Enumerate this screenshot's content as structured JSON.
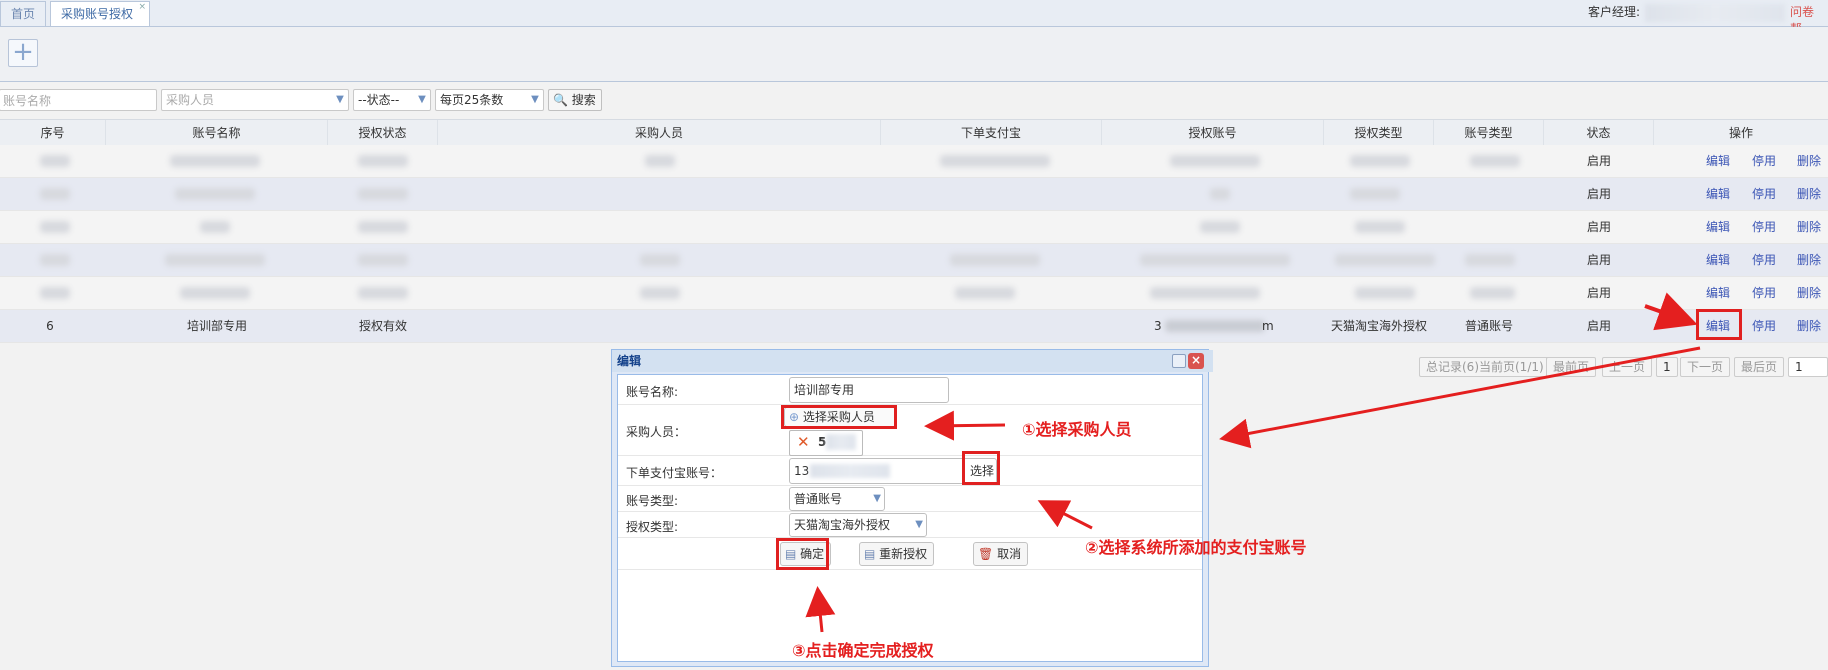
{
  "tabs": [
    {
      "label": "首页"
    },
    {
      "label": "采购账号授权",
      "close": "×"
    }
  ],
  "header": {
    "manager_label": "客户经理:",
    "help_text": "问卷 帮"
  },
  "toolbar": {
    "add_symbol": "+"
  },
  "filters": {
    "account_name_placeholder": "账号名称",
    "buyer_placeholder": "采购人员",
    "status_value": "--状态--",
    "page_size_value": "每页25条数",
    "search_label": "搜索"
  },
  "table": {
    "columns": [
      "序号",
      "账号名称",
      "授权状态",
      "采购人员",
      "下单支付宝",
      "授权账号",
      "授权类型",
      "账号类型",
      "状态",
      "操作"
    ],
    "rows": [
      {
        "status": "启用",
        "edit": "编辑",
        "disable": "停用",
        "delete": "删除"
      },
      {
        "status": "启用",
        "edit": "编辑",
        "disable": "停用",
        "delete": "删除"
      },
      {
        "status": "启用",
        "edit": "编辑",
        "disable": "停用",
        "delete": "删除"
      },
      {
        "status": "启用",
        "edit": "编辑",
        "disable": "停用",
        "delete": "删除"
      },
      {
        "status": "启用",
        "edit": "编辑",
        "disable": "停用",
        "delete": "删除"
      },
      {
        "index": "6",
        "name": "培训部专用",
        "auth_status": "授权有效",
        "auth_account_a": "3",
        "auth_account_b": "m",
        "auth_type": "天猫淘宝海外授权",
        "account_type": "普通账号",
        "status": "启用",
        "edit": "编辑",
        "disable": "停用",
        "delete": "删除"
      }
    ]
  },
  "pager": {
    "summary": "总记录(6)当前页(1/1)",
    "first": "最前页",
    "prev": "上一页",
    "current": "1",
    "next": "下一页",
    "last": "最后页",
    "goto": "1"
  },
  "dialog": {
    "title": "编辑",
    "account_name_label": "账号名称:",
    "account_name_value": "培训部专用",
    "buyer_label": "采购人员：",
    "select_buyer_label": "选择采购人员",
    "buyer_chip": "5",
    "alipay_label": "下单支付宝账号：",
    "alipay_value": "13",
    "choose_label": "选择",
    "account_type_label": "账号类型:",
    "account_type_value": "普通账号",
    "auth_type_label": "授权类型:",
    "auth_type_value": "天猫淘宝海外授权",
    "confirm_label": "确定",
    "reauth_label": "重新授权",
    "cancel_label": "取消"
  },
  "annotations": {
    "step1": "①选择采购人员",
    "step2": "②选择系统所添加的支付宝账号",
    "step3": "③点击确定完成授权"
  },
  "colors": {
    "accent": "#3b55b5",
    "annotation": "#e41f1f"
  }
}
